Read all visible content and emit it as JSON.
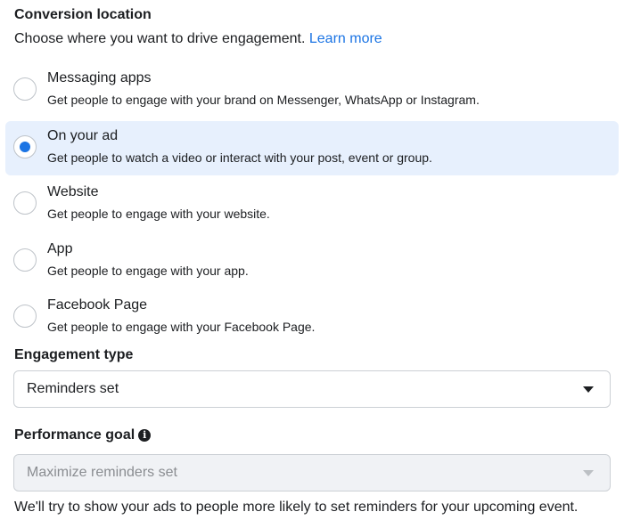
{
  "conversion": {
    "title": "Conversion location",
    "subtitle": "Choose where you want to drive engagement.",
    "learn_more": "Learn more",
    "options": [
      {
        "label": "Messaging apps",
        "desc": "Get people to engage with your brand on Messenger, WhatsApp or Instagram.",
        "selected": false
      },
      {
        "label": "On your ad",
        "desc": "Get people to watch a video or interact with your post, event or group.",
        "selected": true
      },
      {
        "label": "Website",
        "desc": "Get people to engage with your website.",
        "selected": false
      },
      {
        "label": "App",
        "desc": "Get people to engage with your app.",
        "selected": false
      },
      {
        "label": "Facebook Page",
        "desc": "Get people to engage with your Facebook Page.",
        "selected": false
      }
    ]
  },
  "engagement": {
    "title": "Engagement type",
    "value": "Reminders set"
  },
  "performance": {
    "title": "Performance goal",
    "info_icon": "info-icon",
    "value": "Maximize reminders set",
    "disabled": true,
    "helper": "We'll try to show your ads to people more likely to set reminders for your upcoming event."
  },
  "colors": {
    "accent": "#1b74e4",
    "selected_bg": "#e7f0fd",
    "disabled_bg": "#f0f2f5"
  }
}
